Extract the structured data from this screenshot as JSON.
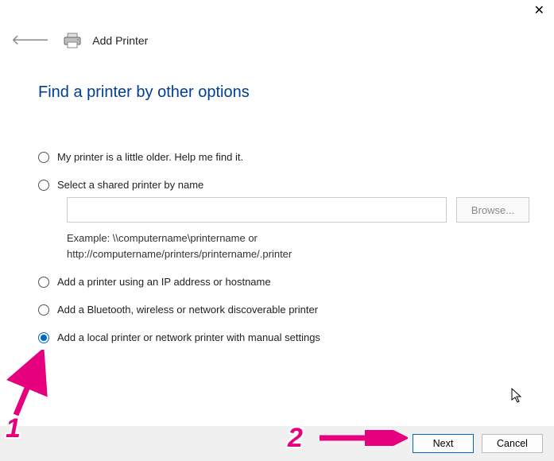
{
  "header": {
    "title": "Add Printer"
  },
  "heading": "Find a printer by other options",
  "options": {
    "older": {
      "label": "My printer is a little older. Help me find it.",
      "selected": false
    },
    "shared": {
      "label": "Select a shared printer by name",
      "selected": false,
      "input_value": "",
      "browse_label": "Browse...",
      "example_line1": "Example: \\\\computername\\printername or",
      "example_line2": "http://computername/printers/printername/.printer"
    },
    "ip": {
      "label": "Add a printer using an IP address or hostname",
      "selected": false
    },
    "bt": {
      "label": "Add a Bluetooth, wireless or network discoverable printer",
      "selected": false
    },
    "local": {
      "label": "Add a local printer or network printer with manual settings",
      "selected": true
    }
  },
  "footer": {
    "next_label": "Next",
    "cancel_label": "Cancel"
  },
  "annotations": {
    "label1": "1",
    "label2": "2",
    "color": "#e6007e"
  }
}
